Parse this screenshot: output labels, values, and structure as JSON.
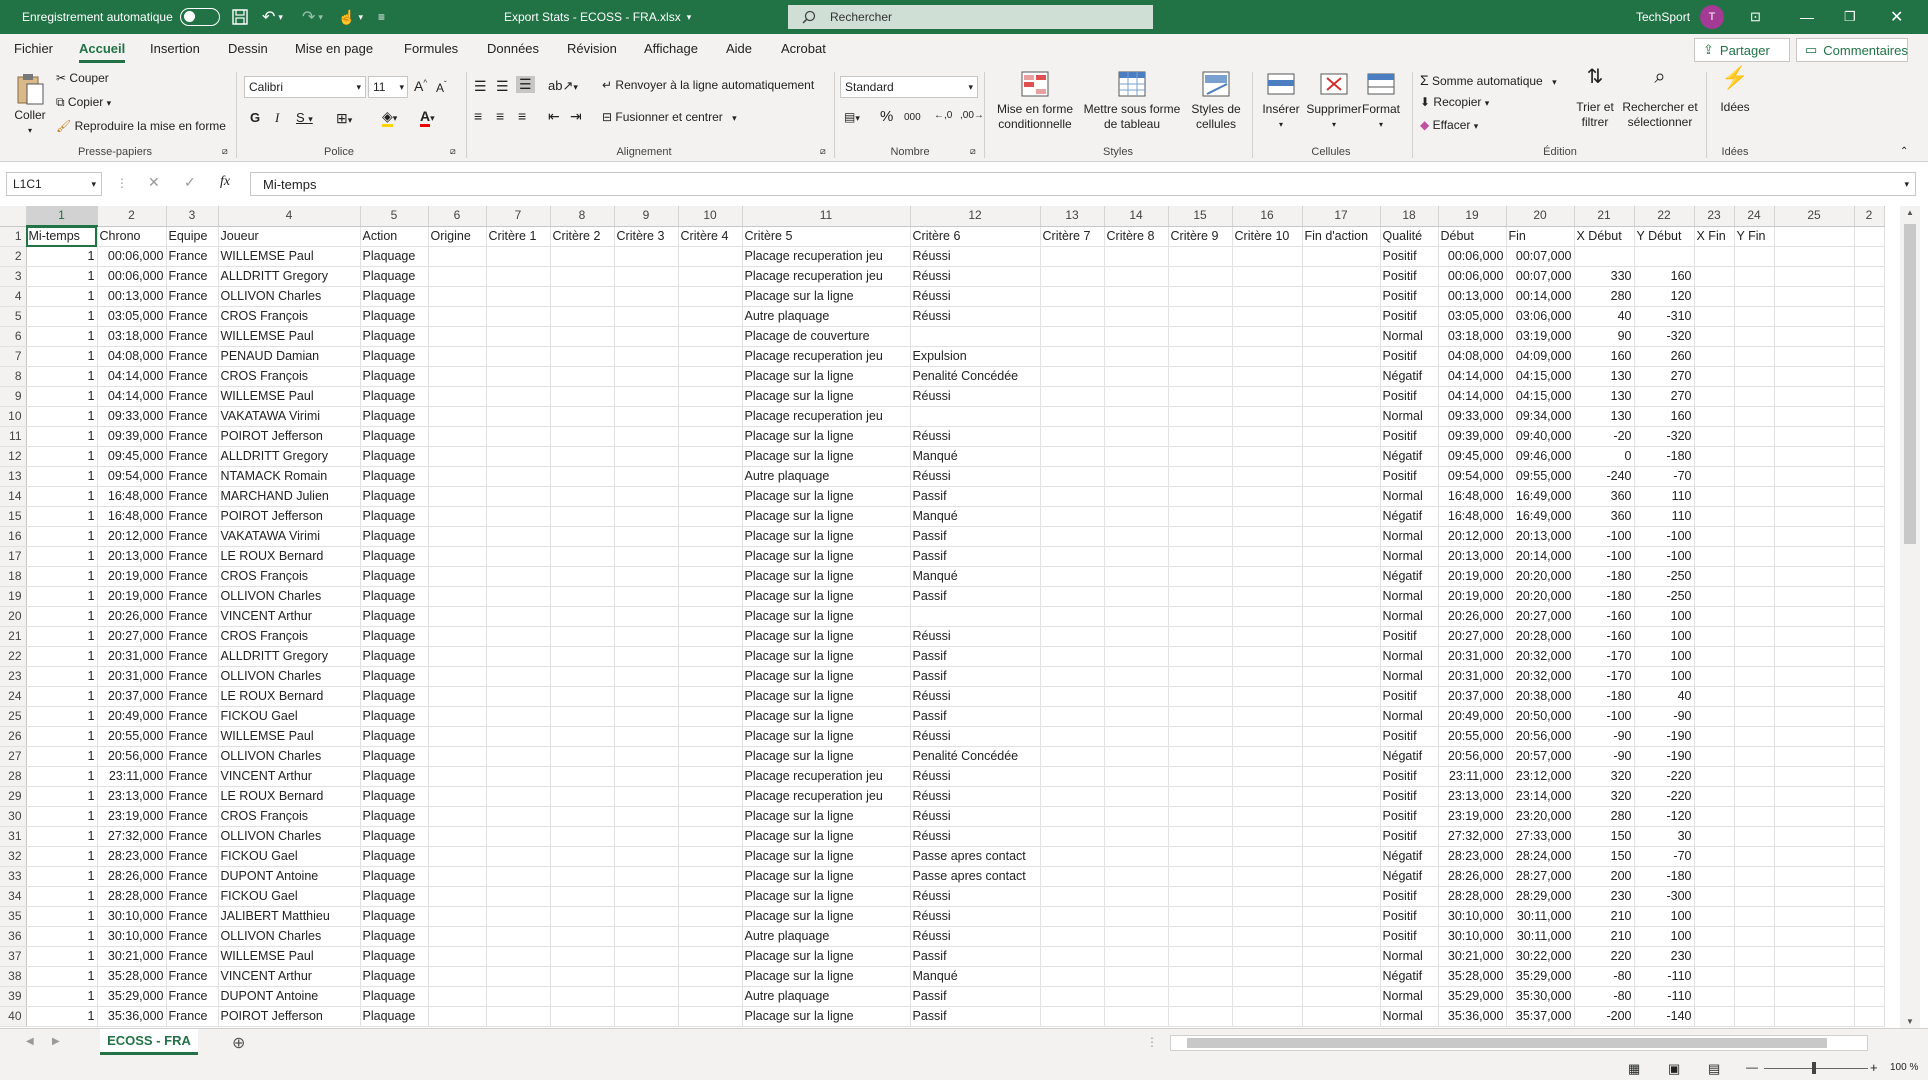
{
  "titlebar": {
    "autosave_label": "Enregistrement automatique",
    "file_title": "Export Stats - ECOSS - FRA.xlsx",
    "search_placeholder": "Rechercher",
    "user_name": "TechSport",
    "user_initial": "T"
  },
  "menu": {
    "tabs": [
      "Fichier",
      "Accueil",
      "Insertion",
      "Dessin",
      "Mise en page",
      "Formules",
      "Données",
      "Révision",
      "Affichage",
      "Aide",
      "Acrobat"
    ],
    "share_label": "Partager",
    "comments_label": "Commentaires"
  },
  "ribbon": {
    "clipboard": {
      "paste": "Coller",
      "cut": "Couper",
      "copy": "Copier",
      "format_painter": "Reproduire la mise en forme",
      "group": "Presse-papiers"
    },
    "font": {
      "name": "Calibri",
      "size": "11",
      "group": "Police"
    },
    "alignment": {
      "wrap": "Renvoyer à la ligne automatiquement",
      "merge": "Fusionner et centrer",
      "group": "Alignement"
    },
    "number": {
      "format": "Standard",
      "group": "Nombre"
    },
    "styles": {
      "conditional": "Mise en forme conditionnelle",
      "as_table": "Mettre sous forme de tableau",
      "cell_styles": "Styles de cellules",
      "group": "Styles"
    },
    "cells": {
      "insert": "Insérer",
      "delete": "Supprimer",
      "format": "Format",
      "group": "Cellules"
    },
    "editing": {
      "autosum": "Somme automatique",
      "fill": "Recopier",
      "clear": "Effacer",
      "sort": "Trier et filtrer",
      "find": "Rechercher et sélectionner",
      "group": "Édition"
    },
    "ideas": {
      "label": "Idées",
      "group": "Idées"
    }
  },
  "formula": {
    "name_box": "L1C1",
    "content": "Mi-temps"
  },
  "col_numbers": [
    "1",
    "2",
    "3",
    "4",
    "5",
    "6",
    "7",
    "8",
    "9",
    "10",
    "11",
    "12",
    "13",
    "14",
    "15",
    "16",
    "17",
    "18",
    "19",
    "20",
    "21",
    "22",
    "23",
    "24",
    "25",
    "2"
  ],
  "headers": [
    "Mi-temps",
    "Chrono",
    "Equipe",
    "Joueur",
    "Action",
    "Origine",
    "Critère 1",
    "Critère 2",
    "Critère 3",
    "Critère 4",
    "Critère 5",
    "Critère 6",
    "Critère 7",
    "Critère 8",
    "Critère 9",
    "Critère 10",
    "Fin d'action",
    "Qualité",
    "Début",
    "Fin",
    "X Début",
    "Y Début",
    "X Fin",
    "Y Fin",
    "",
    ""
  ],
  "rows": [
    [
      "1",
      "00:06,000",
      "France",
      "WILLEMSE Paul",
      "Plaquage",
      "Placage recuperation jeu",
      "Réussi",
      "Positif",
      "00:06,000",
      "00:07,000",
      "",
      ""
    ],
    [
      "1",
      "00:06,000",
      "France",
      "ALLDRITT Gregory",
      "Plaquage",
      "Placage recuperation jeu",
      "Réussi",
      "Positif",
      "00:06,000",
      "00:07,000",
      "330",
      "160"
    ],
    [
      "1",
      "00:13,000",
      "France",
      "OLLIVON Charles",
      "Plaquage",
      "Placage sur la ligne",
      "Réussi",
      "Positif",
      "00:13,000",
      "00:14,000",
      "280",
      "120"
    ],
    [
      "1",
      "03:05,000",
      "France",
      "CROS François",
      "Plaquage",
      "Autre plaquage",
      "Réussi",
      "Positif",
      "03:05,000",
      "03:06,000",
      "40",
      "-310"
    ],
    [
      "1",
      "03:18,000",
      "France",
      "WILLEMSE Paul",
      "Plaquage",
      "Placage de couverture",
      "",
      "Normal",
      "03:18,000",
      "03:19,000",
      "90",
      "-320"
    ],
    [
      "1",
      "04:08,000",
      "France",
      "PENAUD Damian",
      "Plaquage",
      "Placage recuperation jeu",
      "Expulsion",
      "Positif",
      "04:08,000",
      "04:09,000",
      "160",
      "260"
    ],
    [
      "1",
      "04:14,000",
      "France",
      "CROS François",
      "Plaquage",
      "Placage sur la ligne",
      "Penalité Concédée",
      "Négatif",
      "04:14,000",
      "04:15,000",
      "130",
      "270"
    ],
    [
      "1",
      "04:14,000",
      "France",
      "WILLEMSE Paul",
      "Plaquage",
      "Placage sur la ligne",
      "Réussi",
      "Positif",
      "04:14,000",
      "04:15,000",
      "130",
      "270"
    ],
    [
      "1",
      "09:33,000",
      "France",
      "VAKATAWA Virimi",
      "Plaquage",
      "Placage recuperation jeu",
      "",
      "Normal",
      "09:33,000",
      "09:34,000",
      "130",
      "160"
    ],
    [
      "1",
      "09:39,000",
      "France",
      "POIROT Jefferson",
      "Plaquage",
      "Placage sur la ligne",
      "Réussi",
      "Positif",
      "09:39,000",
      "09:40,000",
      "-20",
      "-320"
    ],
    [
      "1",
      "09:45,000",
      "France",
      "ALLDRITT Gregory",
      "Plaquage",
      "Placage sur la ligne",
      "Manqué",
      "Négatif",
      "09:45,000",
      "09:46,000",
      "0",
      "-180"
    ],
    [
      "1",
      "09:54,000",
      "France",
      "NTAMACK Romain",
      "Plaquage",
      "Autre plaquage",
      "Réussi",
      "Positif",
      "09:54,000",
      "09:55,000",
      "-240",
      "-70"
    ],
    [
      "1",
      "16:48,000",
      "France",
      "MARCHAND Julien",
      "Plaquage",
      "Placage sur la ligne",
      "Passif",
      "Normal",
      "16:48,000",
      "16:49,000",
      "360",
      "110"
    ],
    [
      "1",
      "16:48,000",
      "France",
      "POIROT Jefferson",
      "Plaquage",
      "Placage sur la ligne",
      "Manqué",
      "Négatif",
      "16:48,000",
      "16:49,000",
      "360",
      "110"
    ],
    [
      "1",
      "20:12,000",
      "France",
      "VAKATAWA Virimi",
      "Plaquage",
      "Placage sur la ligne",
      "Passif",
      "Normal",
      "20:12,000",
      "20:13,000",
      "-100",
      "-100"
    ],
    [
      "1",
      "20:13,000",
      "France",
      "LE ROUX Bernard",
      "Plaquage",
      "Placage sur la ligne",
      "Passif",
      "Normal",
      "20:13,000",
      "20:14,000",
      "-100",
      "-100"
    ],
    [
      "1",
      "20:19,000",
      "France",
      "CROS François",
      "Plaquage",
      "Placage sur la ligne",
      "Manqué",
      "Négatif",
      "20:19,000",
      "20:20,000",
      "-180",
      "-250"
    ],
    [
      "1",
      "20:19,000",
      "France",
      "OLLIVON Charles",
      "Plaquage",
      "Placage sur la ligne",
      "Passif",
      "Normal",
      "20:19,000",
      "20:20,000",
      "-180",
      "-250"
    ],
    [
      "1",
      "20:26,000",
      "France",
      "VINCENT Arthur",
      "Plaquage",
      "Placage sur la ligne",
      "",
      "Normal",
      "20:26,000",
      "20:27,000",
      "-160",
      "100"
    ],
    [
      "1",
      "20:27,000",
      "France",
      "CROS François",
      "Plaquage",
      "Placage sur la ligne",
      "Réussi",
      "Positif",
      "20:27,000",
      "20:28,000",
      "-160",
      "100"
    ],
    [
      "1",
      "20:31,000",
      "France",
      "ALLDRITT Gregory",
      "Plaquage",
      "Placage sur la ligne",
      "Passif",
      "Normal",
      "20:31,000",
      "20:32,000",
      "-170",
      "100"
    ],
    [
      "1",
      "20:31,000",
      "France",
      "OLLIVON Charles",
      "Plaquage",
      "Placage sur la ligne",
      "Passif",
      "Normal",
      "20:31,000",
      "20:32,000",
      "-170",
      "100"
    ],
    [
      "1",
      "20:37,000",
      "France",
      "LE ROUX Bernard",
      "Plaquage",
      "Placage sur la ligne",
      "Réussi",
      "Positif",
      "20:37,000",
      "20:38,000",
      "-180",
      "40"
    ],
    [
      "1",
      "20:49,000",
      "France",
      "FICKOU Gael",
      "Plaquage",
      "Placage sur la ligne",
      "Passif",
      "Normal",
      "20:49,000",
      "20:50,000",
      "-100",
      "-90"
    ],
    [
      "1",
      "20:55,000",
      "France",
      "WILLEMSE Paul",
      "Plaquage",
      "Placage sur la ligne",
      "Réussi",
      "Positif",
      "20:55,000",
      "20:56,000",
      "-90",
      "-190"
    ],
    [
      "1",
      "20:56,000",
      "France",
      "OLLIVON Charles",
      "Plaquage",
      "Placage sur la ligne",
      "Penalité Concédée",
      "Négatif",
      "20:56,000",
      "20:57,000",
      "-90",
      "-190"
    ],
    [
      "1",
      "23:11,000",
      "France",
      "VINCENT Arthur",
      "Plaquage",
      "Placage recuperation jeu",
      "Réussi",
      "Positif",
      "23:11,000",
      "23:12,000",
      "320",
      "-220"
    ],
    [
      "1",
      "23:13,000",
      "France",
      "LE ROUX Bernard",
      "Plaquage",
      "Placage recuperation jeu",
      "Réussi",
      "Positif",
      "23:13,000",
      "23:14,000",
      "320",
      "-220"
    ],
    [
      "1",
      "23:19,000",
      "France",
      "CROS François",
      "Plaquage",
      "Placage sur la ligne",
      "Réussi",
      "Positif",
      "23:19,000",
      "23:20,000",
      "280",
      "-120"
    ],
    [
      "1",
      "27:32,000",
      "France",
      "OLLIVON Charles",
      "Plaquage",
      "Placage sur la ligne",
      "Réussi",
      "Positif",
      "27:32,000",
      "27:33,000",
      "150",
      "30"
    ],
    [
      "1",
      "28:23,000",
      "France",
      "FICKOU Gael",
      "Plaquage",
      "Placage sur la ligne",
      "Passe apres contact",
      "Négatif",
      "28:23,000",
      "28:24,000",
      "150",
      "-70"
    ],
    [
      "1",
      "28:26,000",
      "France",
      "DUPONT Antoine",
      "Plaquage",
      "Placage sur la ligne",
      "Passe apres contact",
      "Négatif",
      "28:26,000",
      "28:27,000",
      "200",
      "-180"
    ],
    [
      "1",
      "28:28,000",
      "France",
      "FICKOU Gael",
      "Plaquage",
      "Placage sur la ligne",
      "Réussi",
      "Positif",
      "28:28,000",
      "28:29,000",
      "230",
      "-300"
    ],
    [
      "1",
      "30:10,000",
      "France",
      "JALIBERT Matthieu",
      "Plaquage",
      "Placage sur la ligne",
      "Réussi",
      "Positif",
      "30:10,000",
      "30:11,000",
      "210",
      "100"
    ],
    [
      "1",
      "30:10,000",
      "France",
      "OLLIVON Charles",
      "Plaquage",
      "Autre plaquage",
      "Réussi",
      "Positif",
      "30:10,000",
      "30:11,000",
      "210",
      "100"
    ],
    [
      "1",
      "30:21,000",
      "France",
      "WILLEMSE Paul",
      "Plaquage",
      "Placage sur la ligne",
      "Passif",
      "Normal",
      "30:21,000",
      "30:22,000",
      "220",
      "230"
    ],
    [
      "1",
      "35:28,000",
      "France",
      "VINCENT Arthur",
      "Plaquage",
      "Placage sur la ligne",
      "Manqué",
      "Négatif",
      "35:28,000",
      "35:29,000",
      "-80",
      "-110"
    ],
    [
      "1",
      "35:29,000",
      "France",
      "DUPONT Antoine",
      "Plaquage",
      "Autre plaquage",
      "Passif",
      "Normal",
      "35:29,000",
      "35:30,000",
      "-80",
      "-110"
    ],
    [
      "1",
      "35:36,000",
      "France",
      "POIROT Jefferson",
      "Plaquage",
      "Placage sur la ligne",
      "Passif",
      "Normal",
      "35:36,000",
      "35:37,000",
      "-200",
      "-140"
    ]
  ],
  "sheet": {
    "tab": "ECOSS - FRA",
    "zoom": "100 %"
  },
  "colors": {
    "accent": "#217346",
    "ribbon_bg": "#f3f2f1"
  }
}
